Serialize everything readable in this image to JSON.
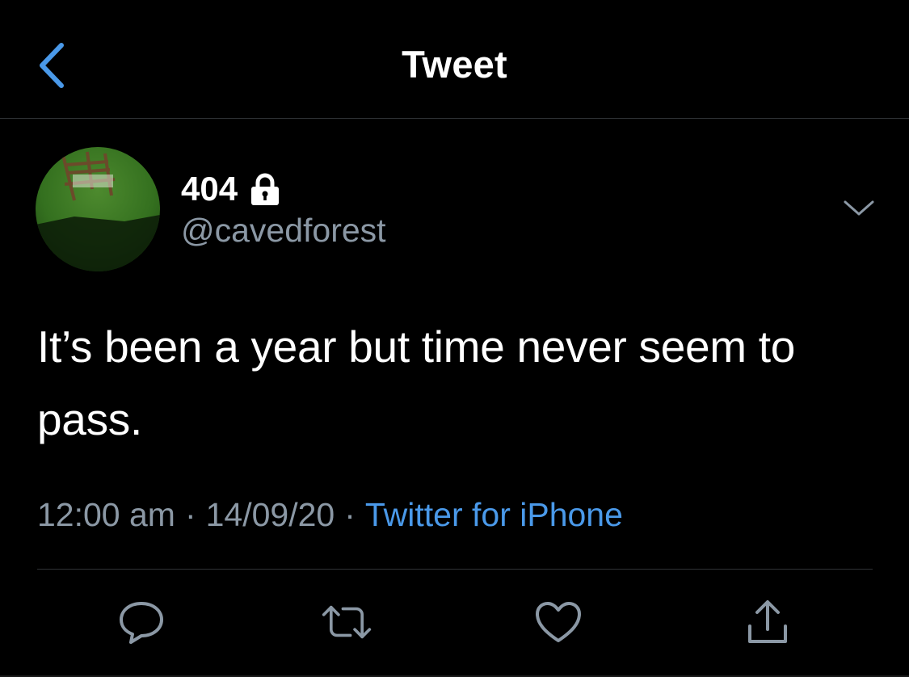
{
  "header": {
    "title": "Tweet",
    "back_icon": "chevron-left-icon"
  },
  "colors": {
    "background": "#000000",
    "text": "#ffffff",
    "secondary_text": "#8b98a5",
    "accent": "#4a99e9",
    "divider": "#2f3336",
    "icon_gray": "#8b98a5"
  },
  "tweet": {
    "author": {
      "display_name": "404",
      "username": "@cavedforest",
      "protected_icon": "lock-icon",
      "avatar": "avatar-image"
    },
    "menu_icon": "chevron-down-icon",
    "text_line1": "It’s been a year but time never seem to",
    "text_line2": "pass.",
    "time": "12:00 am",
    "separator": "·",
    "date": "14/09/20",
    "source": "Twitter for iPhone"
  },
  "actions": [
    {
      "name": "reply",
      "icon": "reply-icon"
    },
    {
      "name": "retweet",
      "icon": "retweet-icon"
    },
    {
      "name": "like",
      "icon": "heart-icon"
    },
    {
      "name": "share",
      "icon": "share-icon"
    }
  ]
}
